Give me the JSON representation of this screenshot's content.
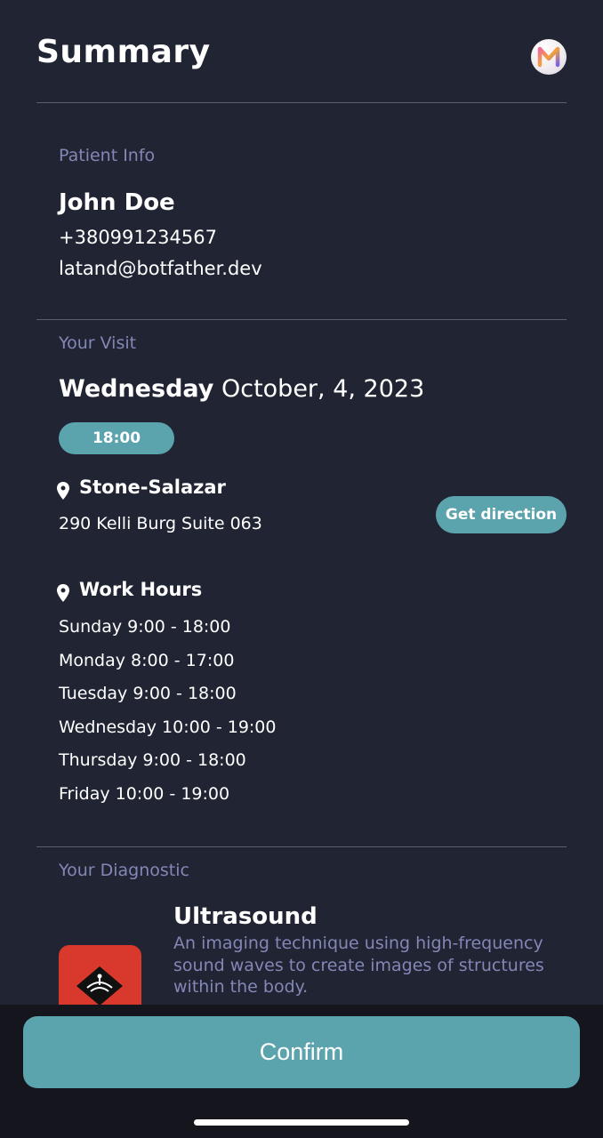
{
  "header": {
    "title": "Summary",
    "avatar_letter": "M"
  },
  "patient": {
    "label": "Patient Info",
    "name": "John Doe",
    "phone": "+380991234567",
    "email": "latand@botfather.dev"
  },
  "visit": {
    "label": "Your Visit",
    "weekday": "Wednesday",
    "date": "October, 4, 2023",
    "time": "18:00",
    "location_name": "Stone-Salazar",
    "address": "290 Kelli Burg Suite 063",
    "direction_label": "Get direction",
    "work_hours_title": "Work Hours",
    "work_hours": [
      "Sunday 9:00 - 18:00",
      "Monday 8:00 - 17:00",
      "Tuesday 9:00 - 18:00",
      "Wednesday 10:00 - 19:00",
      "Thursday 9:00 - 18:00",
      "Friday 10:00 - 19:00"
    ]
  },
  "diagnostic": {
    "label": "Your Diagnostic",
    "title": "Ultrasound",
    "description": "An imaging technique using high-frequency sound waves to create images of structures within the body."
  },
  "footer": {
    "confirm_label": "Confirm"
  },
  "icons": {
    "pin": "map-pin-icon",
    "diagnostic": "ultrasound-icon"
  },
  "colors": {
    "background": "#212433",
    "accent": "#5ba3ad",
    "muted_label": "#8387b6",
    "footer": "#15161d",
    "thumb": "#d9392c"
  }
}
